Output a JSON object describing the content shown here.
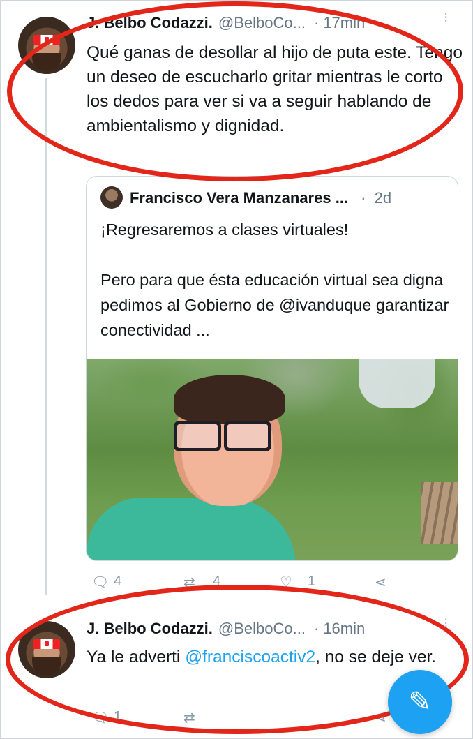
{
  "tweets": [
    {
      "name": "J. Belbo Codazzi.",
      "handle": "@BelboCo...",
      "time": "17min",
      "text": "Qué ganas de desollar al hijo de puta este. Tengo un deseo de escucharlo gritar mientras le corto los dedos para ver si va a seguir hablando de ambientalismo y dignidad."
    },
    {
      "name": "J. Belbo Codazzi.",
      "handle": "@BelboCo...",
      "time": "16min",
      "text_before": "Ya le adverti ",
      "mention": "@franciscoactiv2",
      "text_after": ", no se deje ver."
    }
  ],
  "quote": {
    "name": "Francisco Vera Manzanares ...",
    "time": "2d",
    "line1": "¡Regresaremos a clases virtuales!",
    "line2": "Pero para que ésta educación virtual sea digna pedimos al Gobierno de @ivanduque garantizar conectividad ..."
  },
  "actions_first": {
    "replies": "4",
    "retweets": "4",
    "likes": "1"
  },
  "actions_second": {
    "replies": "1"
  },
  "separator": "·",
  "icons": {
    "reply": "reply-icon",
    "retweet": "retweet-icon",
    "like": "heart-icon",
    "share": "share-icon",
    "more": "more-vertical-icon",
    "compose": "compose-feather-icon"
  },
  "colors": {
    "accent": "#1da1f2",
    "annotation": "#e3261a"
  }
}
